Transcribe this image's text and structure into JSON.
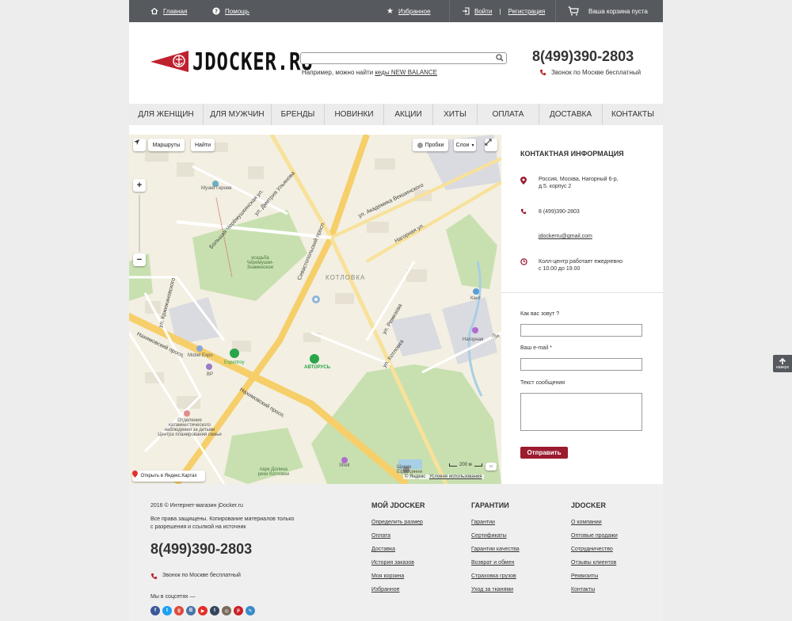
{
  "topbar": {
    "home": "Главная",
    "help": "Помощь",
    "favorites": "Избранное",
    "login": "Войти",
    "separator": "|",
    "register": "Регистрация",
    "cart": "Ваша корзина пуста"
  },
  "header": {
    "logo_text": "JDOCKER.RU",
    "search_placeholder": "",
    "search_hint_prefix": "Например, можно найти ",
    "search_hint_link": "кеды NEW BALANCE",
    "phone": "8(499)390-2803",
    "phone_note": "Звонок по Москве бесплатный"
  },
  "nav": [
    {
      "label": "Для женщин"
    },
    {
      "label": "Для мужчин"
    },
    {
      "label": "Бренды"
    },
    {
      "label": "Новинки"
    },
    {
      "label": "Акции"
    },
    {
      "label": "Хиты"
    },
    {
      "label": "Оплата"
    },
    {
      "label": "Доставка"
    },
    {
      "label": "Контакты"
    }
  ],
  "map": {
    "routes": "Маршруты",
    "find": "Найти",
    "traffic": "Пробки",
    "layers": "Слои",
    "zoom_in": "+",
    "zoom_out": "−",
    "open_in": "Открыть в Яндекс.Картах",
    "scale": "200 м",
    "copyright": "© Яндекс",
    "terms": "Условия использования",
    "labels": {
      "museum": "Музей Героев",
      "park": "усадьба Черемушки-Знаменское",
      "district": "КОТЛОВКА",
      "mobel": "Mobel Expo",
      "expert": "Expertroy",
      "bp": "BP",
      "avtorus": "АВТОРУСЬ",
      "kant": "Кант",
      "nagornaya": "Нагорная",
      "shell": "Shell",
      "luk": "Лук",
      "clinic": "Отделение катамнестического наблюдения за детьми Центра планирования семьи",
      "kotlovka_park": "парк Долина реки Котловки",
      "efosinnia": "Щекин Ефросинни"
    },
    "roads": {
      "sevastopol": "Севастопольский просп.",
      "ulyanova": "ул. Дмитрия Ульянова",
      "cheremush": "Большая Черёмушкинская ул.",
      "veshnyakov": "ул. Академика Векшинского",
      "nagornaya_ul": "Нагорная ул.",
      "nakhim1": "Нахимовский просп.",
      "nakhim2": "Нахимовский просп.",
      "remizova": "ул. Ремизова",
      "krzhizh": "ул. Кржижановского",
      "kotlovka_ul": "ул. Котловка"
    }
  },
  "contact": {
    "title": "Контактная информация",
    "address_line1": "Россия, Москва, Нагорный 6-р,",
    "address_line2": "д.5. корпус 2",
    "phone": "8 (499)390-2803",
    "email": "jdockerru@gmail.com",
    "hours_line1": "Колл-центр работает ежедневно",
    "hours_line2": "с 10.00 до 19.00"
  },
  "form": {
    "name_label": "Как вас зовут ?",
    "email_label": "Ваш e-mail *",
    "message_label": "Текст сообщения",
    "submit": "Отправить"
  },
  "footer": {
    "copyright": "2016 © Интернет-магазин jDocker.ru",
    "rights_line1": "Все права защищены. Копирование материалов только",
    "rights_line2": "с разрешения и ссылкой на источник",
    "phone": "8(499)390-2803",
    "phone_note": "Звонок по Москве бесплатный",
    "social_label": "Мы в соцсетях —",
    "col1_title": "Мой JDocker",
    "col1": [
      "Определить размер",
      "Оплата",
      "Доставка",
      "История заказов",
      "Моя корзина",
      "Избранное"
    ],
    "col2_title": "Гарантии",
    "col2": [
      "Гарантии",
      "Сертификаты",
      "Гарантии качества",
      "Возврат и обмен",
      "Страховка грузов",
      "Уход за тканями"
    ],
    "col3_title": "JDocker",
    "col3": [
      "О компании",
      "Оптовые продажи",
      "Сотрудничество",
      "Отзывы клиентов",
      "Реквизиты",
      "Контакты"
    ]
  },
  "totop": "наверх",
  "colors": {
    "topbar": "#56595d",
    "accent": "#9b1b2f",
    "nav_bg": "#ececec",
    "footer_bg": "#efefef"
  }
}
